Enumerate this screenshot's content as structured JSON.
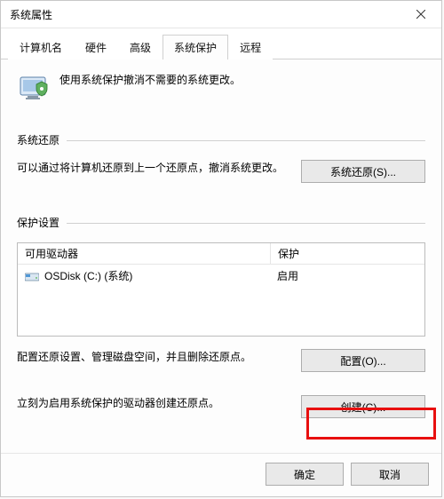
{
  "titlebar": {
    "title": "系统属性"
  },
  "tabs": {
    "items": [
      {
        "label": "计算机名"
      },
      {
        "label": "硬件"
      },
      {
        "label": "高级"
      },
      {
        "label": "系统保护"
      },
      {
        "label": "远程"
      }
    ],
    "active_index": 3
  },
  "intro_text": "使用系统保护撤消不需要的系统更改。",
  "group_restore": {
    "title": "系统还原",
    "desc": "可以通过将计算机还原到上一个还原点，撤消系统更改。",
    "button": "系统还原(S)..."
  },
  "group_protect": {
    "title": "保护设置",
    "table": {
      "col_drive": "可用驱动器",
      "col_status": "保护",
      "rows": [
        {
          "name": "OSDisk (C:) (系统)",
          "status": "启用"
        }
      ]
    },
    "config": {
      "desc": "配置还原设置、管理磁盘空间，并且删除还原点。",
      "button": "配置(O)..."
    },
    "create": {
      "desc": "立刻为启用系统保护的驱动器创建还原点。",
      "button": "创建(C)..."
    }
  },
  "footer": {
    "ok": "确定",
    "cancel": "取消"
  }
}
